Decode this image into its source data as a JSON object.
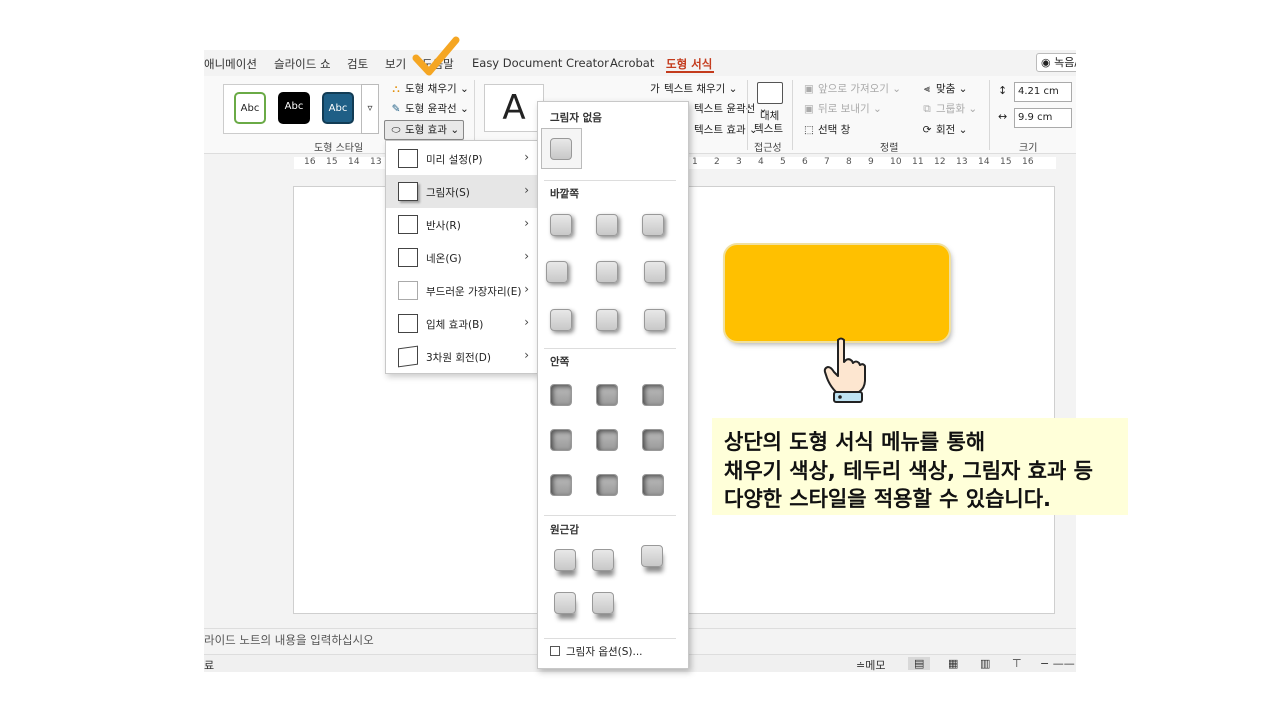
{
  "tabs": [
    {
      "label": "애니메이션"
    },
    {
      "label": "슬라이드 쇼"
    },
    {
      "label": "검토"
    },
    {
      "label": "보기"
    },
    {
      "label": "도움말"
    },
    {
      "label": "Easy Document Creator"
    },
    {
      "label": "Acrobat"
    },
    {
      "label": "도형 서식"
    }
  ],
  "record_label": "녹음/",
  "ribbon": {
    "style_samples": [
      "Abc",
      "Abc",
      "Abc"
    ],
    "shape_fill": "도형 채우기",
    "shape_outline": "도형 윤곽선",
    "shape_effects": "도형 효과",
    "shape_styles_group": "도형 스타일",
    "text_fill": "텍스트 채우기",
    "text_outline": "텍스트 윤곽선",
    "text_effects": "텍스트 효과",
    "wordart_letter": "A",
    "alt_text_line1": "대체",
    "alt_text_line2": "텍스트",
    "accessibility_group": "접근성",
    "bring_forward": "앞으로 가져오기",
    "send_backward": "뒤로 보내기",
    "selection_pane": "선택 창",
    "align": "맞춤",
    "group": "그룹화",
    "rotate": "회전",
    "arrange_group": "정렬",
    "height_value": "4.21 cm",
    "width_value": "9.9 cm",
    "size_group": "크기"
  },
  "ruler_labels": [
    "16",
    "15",
    "14",
    "13",
    "1",
    "2",
    "3",
    "4",
    "5",
    "6",
    "7",
    "8",
    "9",
    "10",
    "11",
    "12",
    "13",
    "14",
    "15",
    "16"
  ],
  "effects_menu": [
    {
      "label": "미리 설정(P)"
    },
    {
      "label": "그림자(S)"
    },
    {
      "label": "반사(R)"
    },
    {
      "label": "네온(G)"
    },
    {
      "label": "부드러운 가장자리(E)"
    },
    {
      "label": "입체 효과(B)"
    },
    {
      "label": "3차원 회전(D)"
    }
  ],
  "shadow_menu": {
    "no_shadow": "그림자 없음",
    "outer": "바깥쪽",
    "inner": "안쪽",
    "perspective": "원근감",
    "options": "그림자 옵션(S)..."
  },
  "callout": {
    "line1": "상단의 도형 서식 메뉴를 통해",
    "line2": "채우기 색상, 테두리 색상, 그림자 효과 등",
    "line3": "다양한 스타일을 적용할 수 있습니다."
  },
  "notes_placeholder": "라이드 노트의 내용을 입력하십시오",
  "status": {
    "left": "료",
    "notes": "메모"
  },
  "colors": {
    "accent_tab": "#c43b1d",
    "shape_fill": "#ffc000",
    "callout_bg": "#ffffd9",
    "checkmark": "#f5a623"
  },
  "icons": [
    "paint-bucket-icon",
    "pen-outline-icon",
    "shape-effects-icon",
    "chevron-right-icon",
    "checkmark-icon",
    "hand-pointer-icon",
    "alt-text-icon"
  ]
}
